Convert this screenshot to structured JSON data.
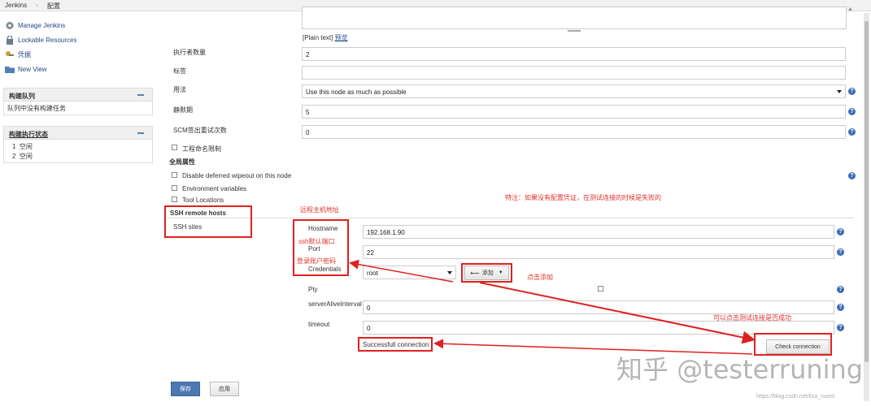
{
  "breadcrumb": {
    "root": "Jenkins",
    "sep": "›",
    "page": "配置"
  },
  "sidebar": {
    "tasks": [
      {
        "label": "Manage Jenkins",
        "icon": "gear-icon"
      },
      {
        "label": "Lockable Resources",
        "icon": "lock-icon"
      },
      {
        "label": "凭据",
        "icon": "credentials-icon"
      },
      {
        "label": "New View",
        "icon": "folder-icon"
      }
    ],
    "build_queue": {
      "title": "构建队列",
      "empty_text": "队列中没有构建任务"
    },
    "executors": {
      "title": "构建执行状态",
      "rows": [
        {
          "num": "1",
          "status": "空闲"
        },
        {
          "num": "2",
          "status": "空闲"
        }
      ]
    }
  },
  "form": {
    "plain_text": "[Plain text]",
    "preview": "预览",
    "executors_label": "执行者数量",
    "executors_value": "2",
    "tags_label": "标签",
    "tags_value": "",
    "usage_label": "用法",
    "usage_value": "Use this node as much as possible",
    "quiet_label": "静默期",
    "quiet_value": "5",
    "scm_label": "SCM签出重试次数",
    "scm_value": "0",
    "project_name_restrict": "工程命名限制",
    "global_props": "全局属性",
    "disable_wipeout": "Disable deferred wipeout on this node",
    "env_vars": "Environment variables",
    "tool_locations": "Tool Locations",
    "ssh_remote_hosts": "SSH remote hosts",
    "ssh_sites": "SSH sites",
    "hostname_label": "Hostname",
    "hostname_value": "192.168.1.90",
    "port_label": "Port",
    "port_value": "22",
    "credentials_label": "Credentials",
    "credentials_value": "root",
    "add_button": "添加",
    "pty_label": "Pty",
    "server_alive_label": "serverAliveInterval",
    "server_alive_value": "0",
    "timeout_label": "timeout",
    "timeout_value": "0",
    "check_connection": "Check connection",
    "connection_result": "Successfull connection",
    "save_button": "保存",
    "apply_button": "应用"
  },
  "annotations": {
    "note_no_credential": "特注：如果没有配置凭证，在测试连接的时候是失败的",
    "remote_host_addr": "远程主机地址",
    "ssh_default_port": "ssh默认端口",
    "login_credentials": "登录账户密码",
    "click_add": "点击添加",
    "click_test": "可以点击测试连接是否成功"
  },
  "watermark": {
    "zhihu": "知乎 @testerruning",
    "url": "https://blog.csdn.net/lisa_ruoes"
  },
  "colors": {
    "annotation_red": "#e02020",
    "primary_button": "#4b78b0",
    "help_icon": "#3c6eb4"
  }
}
